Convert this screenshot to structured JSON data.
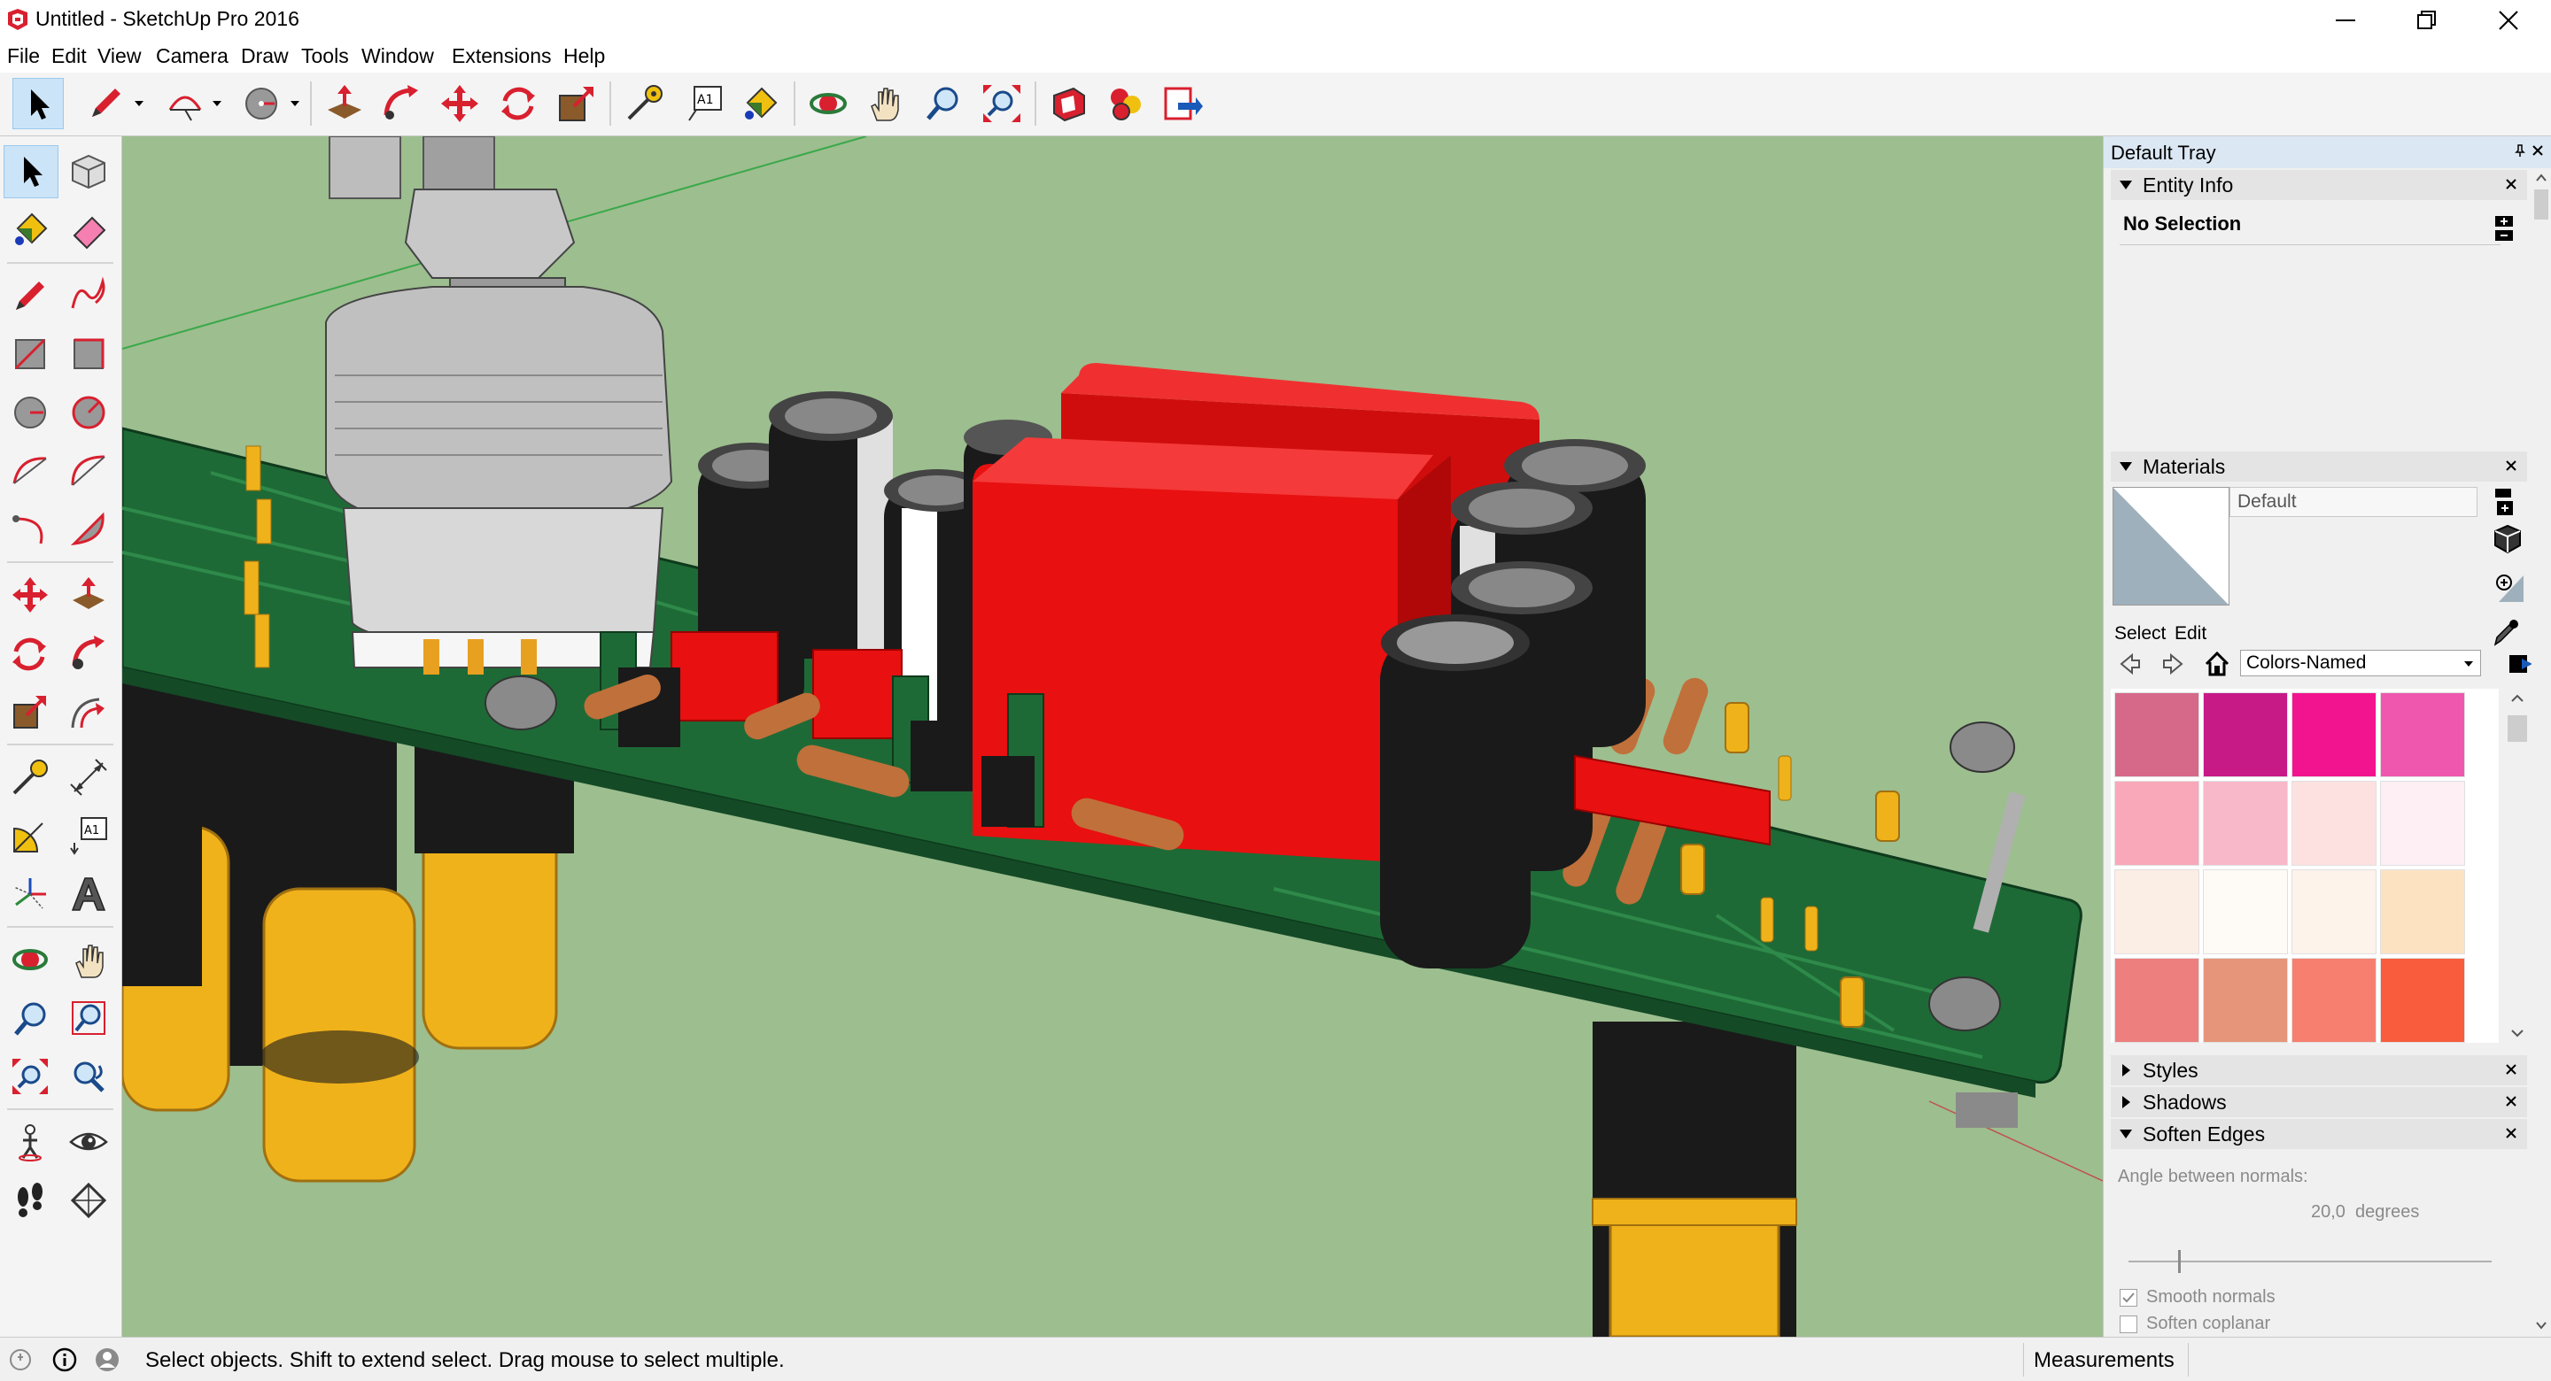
{
  "window": {
    "title": "Untitled - SketchUp Pro 2016"
  },
  "menu": [
    "File",
    "Edit",
    "View",
    "Camera",
    "Draw",
    "Tools",
    "Window",
    "Extensions",
    "Help"
  ],
  "tray": {
    "title": "Default Tray",
    "entity_info": {
      "title": "Entity Info",
      "selection": "No Selection"
    },
    "materials": {
      "title": "Materials",
      "current_name": "Default",
      "tabs": [
        "Select",
        "Edit"
      ],
      "library": "Colors-Named",
      "swatches": [
        "#d6698a",
        "#c71a87",
        "#f2148e",
        "#ef57ae",
        "#f9a8b9",
        "#f8b8c9",
        "#fde1e0",
        "#fdeff3",
        "#fbeee4",
        "#fefbf7",
        "#fdf3ea",
        "#fde2c2",
        "#ee7f7f",
        "#e6957a",
        "#f67f6f",
        "#f85c3d"
      ]
    },
    "styles": {
      "title": "Styles"
    },
    "shadows": {
      "title": "Shadows"
    },
    "soften_edges": {
      "title": "Soften Edges",
      "angle_label": "Angle between normals:",
      "angle_value": "20,0  degrees",
      "smooth_normals": "Smooth normals",
      "soften_coplanar": "Soften coplanar"
    }
  },
  "status": {
    "hint": "Select objects. Shift to extend select. Drag mouse to select multiple.",
    "measurements_label": "Measurements"
  },
  "colors": {
    "viewport_bg": "#9dbe8f",
    "pcb": "#1e6a36",
    "component_red": "#e81010",
    "capacitor_black": "#1a1a1a",
    "gold": "#f0b21a"
  }
}
